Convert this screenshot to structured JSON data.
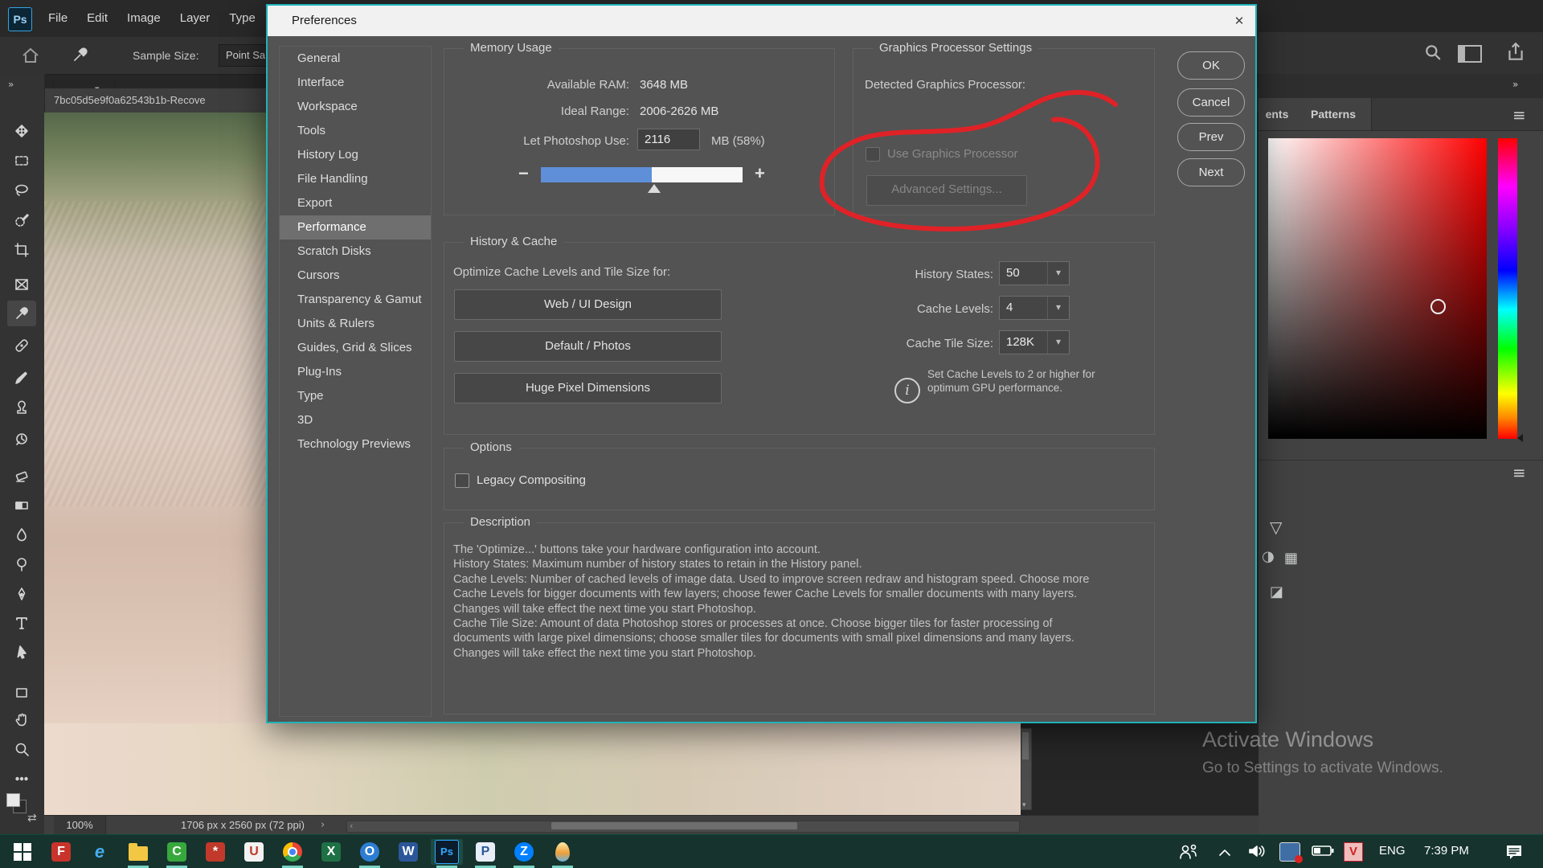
{
  "colors": {
    "annotation": "#e02227",
    "accent_blue": "#5e8fd8",
    "dialog_border_teal": "#1fb3b8",
    "taskbar_green": "#16332d",
    "ps_brand_blue": "#31a8ff"
  },
  "app": {
    "logo": "Ps",
    "menu": [
      "File",
      "Edit",
      "Image",
      "Layer",
      "Type"
    ],
    "window_controls": [
      "minimize",
      "maximize",
      "close"
    ],
    "options_bar": {
      "sample_size_label": "Sample Size:",
      "sample_size_value": "Point Sa"
    },
    "document_tab": "7bc05d5e9f0a62543b1b-Recove",
    "status": {
      "zoom": "100%",
      "doc_info": "1706 px x 2560 px (72 ppi)"
    }
  },
  "toolbar": {
    "tools": [
      {
        "name": "move-tool",
        "icon": "move"
      },
      {
        "name": "marquee-tool",
        "icon": "marquee"
      },
      {
        "name": "lasso-tool",
        "icon": "lasso"
      },
      {
        "name": "quick-selection-tool",
        "icon": "quickselect"
      },
      {
        "name": "crop-tool",
        "icon": "crop"
      },
      {
        "name": "frame-tool",
        "icon": "frame"
      },
      {
        "name": "eyedropper-tool",
        "icon": "eyedropper",
        "selected": true
      },
      {
        "name": "healing-brush-tool",
        "icon": "healing"
      },
      {
        "name": "brush-tool",
        "icon": "brush"
      },
      {
        "name": "clone-stamp-tool",
        "icon": "stamp"
      },
      {
        "name": "history-brush-tool",
        "icon": "historybrush"
      },
      {
        "name": "eraser-tool",
        "icon": "eraser"
      },
      {
        "name": "gradient-tool",
        "icon": "gradient"
      },
      {
        "name": "blur-tool",
        "icon": "blur"
      },
      {
        "name": "dodge-tool",
        "icon": "dodge"
      },
      {
        "name": "pen-tool",
        "icon": "pen"
      },
      {
        "name": "type-tool",
        "icon": "type"
      },
      {
        "name": "path-select-tool",
        "icon": "pathselect"
      },
      {
        "name": "shape-tool",
        "icon": "shape"
      },
      {
        "name": "hand-tool",
        "icon": "hand"
      },
      {
        "name": "zoom-tool",
        "icon": "zoommag"
      },
      {
        "name": "more-tools",
        "icon": "more"
      }
    ]
  },
  "dialog": {
    "title": "Preferences",
    "sidebar": [
      "General",
      "Interface",
      "Workspace",
      "Tools",
      "History Log",
      "File Handling",
      "Export",
      "Performance",
      "Scratch Disks",
      "Cursors",
      "Transparency & Gamut",
      "Units & Rulers",
      "Guides, Grid & Slices",
      "Plug-Ins",
      "Type",
      "3D",
      "Technology Previews"
    ],
    "selected_item": "Performance",
    "memory": {
      "title": "Memory Usage",
      "available_label": "Available RAM:",
      "available_value": "3648 MB",
      "ideal_label": "Ideal Range:",
      "ideal_value": "2006-2626 MB",
      "use_label": "Let Photoshop Use:",
      "use_value": "2116",
      "use_suffix": "MB (58%)",
      "slider_fill_percent": 55
    },
    "gpu": {
      "title": "Graphics Processor Settings",
      "detected_label": "Detected Graphics Processor:",
      "checkbox_label": "Use Graphics Processor",
      "advanced_button": "Advanced Settings..."
    },
    "history_cache": {
      "title": "History & Cache",
      "optimize_label": "Optimize Cache Levels and Tile Size for:",
      "optimize_buttons": [
        "Web / UI Design",
        "Default / Photos",
        "Huge Pixel Dimensions"
      ],
      "history_states_label": "History States:",
      "history_states_value": "50",
      "cache_levels_label": "Cache Levels:",
      "cache_levels_value": "4",
      "cache_tile_label": "Cache Tile Size:",
      "cache_tile_value": "128K",
      "tip": "Set Cache Levels to 2 or higher for optimum GPU performance."
    },
    "options": {
      "title": "Options",
      "legacy_label": "Legacy Compositing"
    },
    "description": {
      "title": "Description",
      "lines": [
        "The 'Optimize...' buttons take your hardware configuration into account.",
        "History States: Maximum number of history states to retain in the History panel.",
        "Cache Levels: Number of cached levels of image data.  Used to improve screen redraw and histogram speed.  Choose more",
        "Cache Levels for bigger documents with few layers; choose fewer Cache Levels for smaller documents with many layers.",
        "Changes will take effect the next time you start Photoshop.",
        "Cache Tile Size: Amount of data Photoshop stores or processes at once. Choose bigger tiles for faster processing of",
        "documents with large pixel dimensions; choose smaller tiles for documents with small pixel dimensions and many layers.",
        "Changes will take effect the next time you start Photoshop."
      ]
    },
    "action_buttons": [
      "OK",
      "Cancel",
      "Prev",
      "Next"
    ]
  },
  "panels": {
    "tabs": [
      "ents",
      "Patterns"
    ],
    "activate_line1": "Activate Windows",
    "activate_line2": "Go to Settings to activate Windows."
  },
  "taskbar": {
    "lang": "ENG",
    "clock": "7:39 PM",
    "apps": [
      {
        "name": "start-button",
        "type": "winlogo"
      },
      {
        "name": "foxit-reader",
        "label": "F",
        "fg": "#ffffff",
        "bg": "#c8332b"
      },
      {
        "name": "internet-explorer",
        "label": "e",
        "fg": "#45aef0",
        "bg": "none",
        "open": false
      },
      {
        "name": "file-explorer",
        "type": "folder",
        "open": true
      },
      {
        "name": "camtasia",
        "label": "C",
        "fg": "#ffffff",
        "bg": "#37a93c",
        "open": true
      },
      {
        "name": "paint-app",
        "label": "*",
        "fg": "#ffffff",
        "bg": "#c0392b"
      },
      {
        "name": "unikey",
        "label": "U",
        "fg": "#c0392b",
        "bg": "#f2f2f2"
      },
      {
        "name": "chrome",
        "type": "chrome",
        "open": true
      },
      {
        "name": "excel",
        "label": "X",
        "fg": "#ffffff",
        "bg": "#1e7145"
      },
      {
        "name": "blue-circle-app",
        "label": "O",
        "fg": "#ffffff",
        "bg": "#2d7dd2",
        "round": true,
        "open": true
      },
      {
        "name": "word",
        "label": "W",
        "fg": "#ffffff",
        "bg": "#2b579a"
      },
      {
        "name": "photoshop",
        "type": "ps",
        "active": true,
        "open": true
      },
      {
        "name": "office-viewer",
        "label": "P",
        "fg": "#2b579a",
        "bg": "#e8eef7",
        "open": true
      },
      {
        "name": "zalo",
        "label": "Z",
        "fg": "#ffffff",
        "bg": "#0180ff",
        "round": true,
        "open": true
      },
      {
        "name": "coccoc-browser",
        "type": "drop",
        "open": true
      }
    ]
  }
}
